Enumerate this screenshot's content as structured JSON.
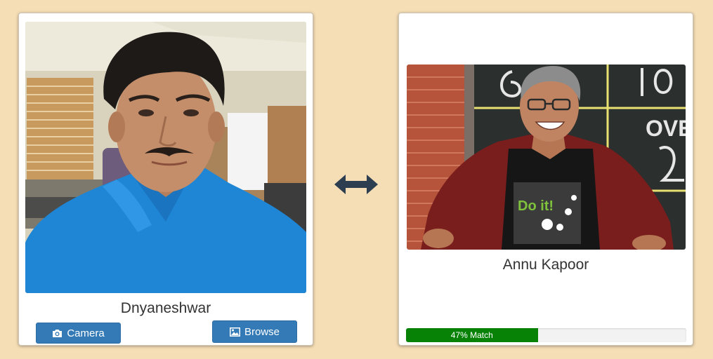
{
  "left_panel": {
    "photo_alt": "Dnyaneshwar",
    "name": "Dnyaneshwar",
    "camera_button": {
      "label": "Camera",
      "icon": "camera-icon"
    },
    "browse_button": {
      "label": "Browse",
      "icon": "image-icon"
    }
  },
  "center": {
    "icon": "swap-arrow-icon",
    "color": "#2c3e50"
  },
  "right_panel": {
    "photo_alt": "Annu Kapoor",
    "name": "Annu Kapoor",
    "match": {
      "label": "47% Match",
      "percent": 47,
      "color": "#078207"
    },
    "shirt_text": "Do it!",
    "chalkboard_text": "OVE"
  },
  "colors": {
    "background": "#f5deb6",
    "button": "#337ab7"
  }
}
